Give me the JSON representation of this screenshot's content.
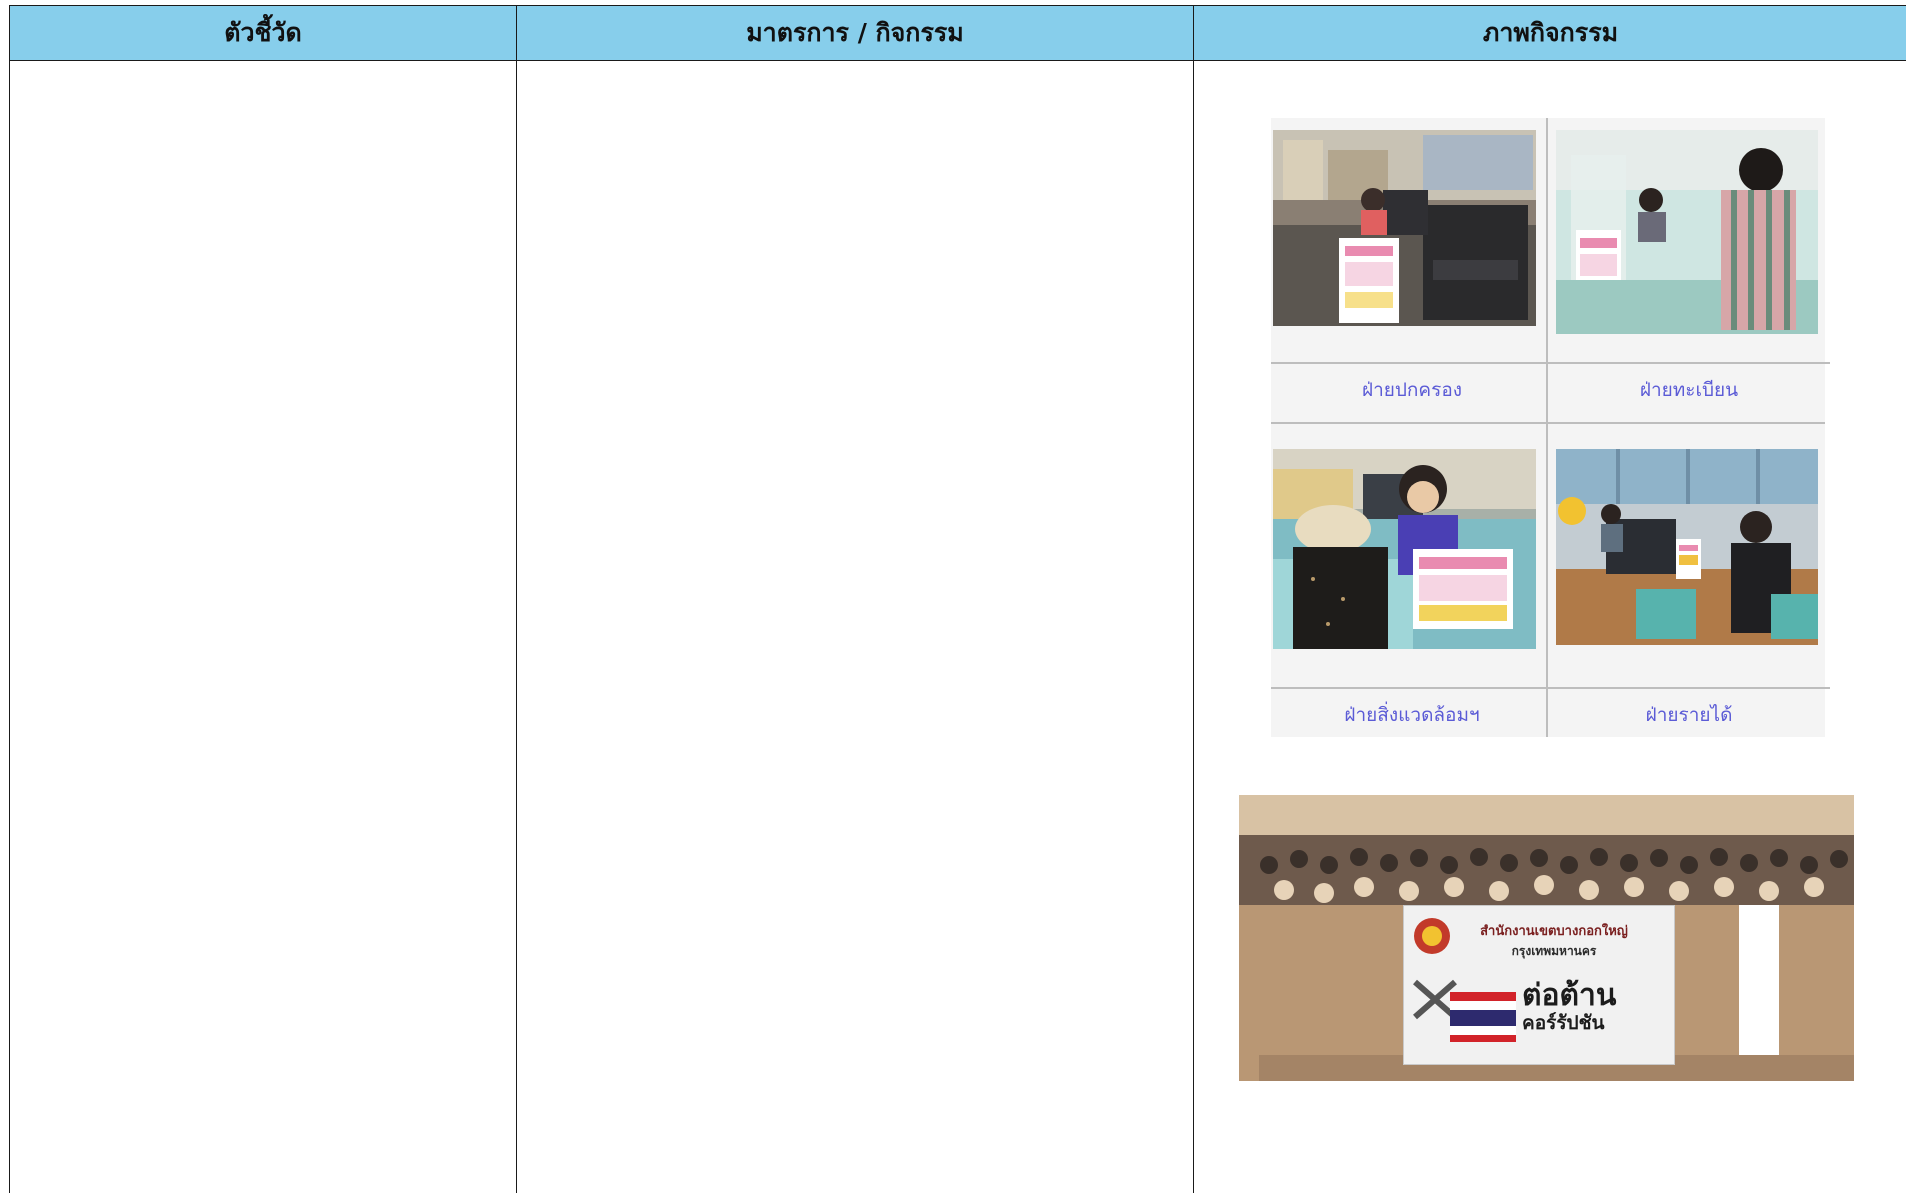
{
  "table": {
    "headers": [
      "ตัวชี้วัด",
      "มาตรการ / กิจกรรม",
      "ภาพกิจกรรม"
    ]
  },
  "gallery": {
    "captions": [
      "ฝ่ายปกครอง",
      "ฝ่ายทะเบียน",
      "ฝ่ายสิ่งแวดล้อมฯ",
      "ฝ่ายรายได้"
    ],
    "caption_color": "#5b5bd6"
  },
  "photo_banner": {
    "line1": "สำนักงานเขตบางกอกใหญ่",
    "line2": "กรุงเทพมหานคร",
    "big": "ต่อต้าน",
    "small": "คอร์รัปชัน"
  },
  "colors": {
    "header_bg": "#87ceeb",
    "border": "#1a1a1a"
  }
}
